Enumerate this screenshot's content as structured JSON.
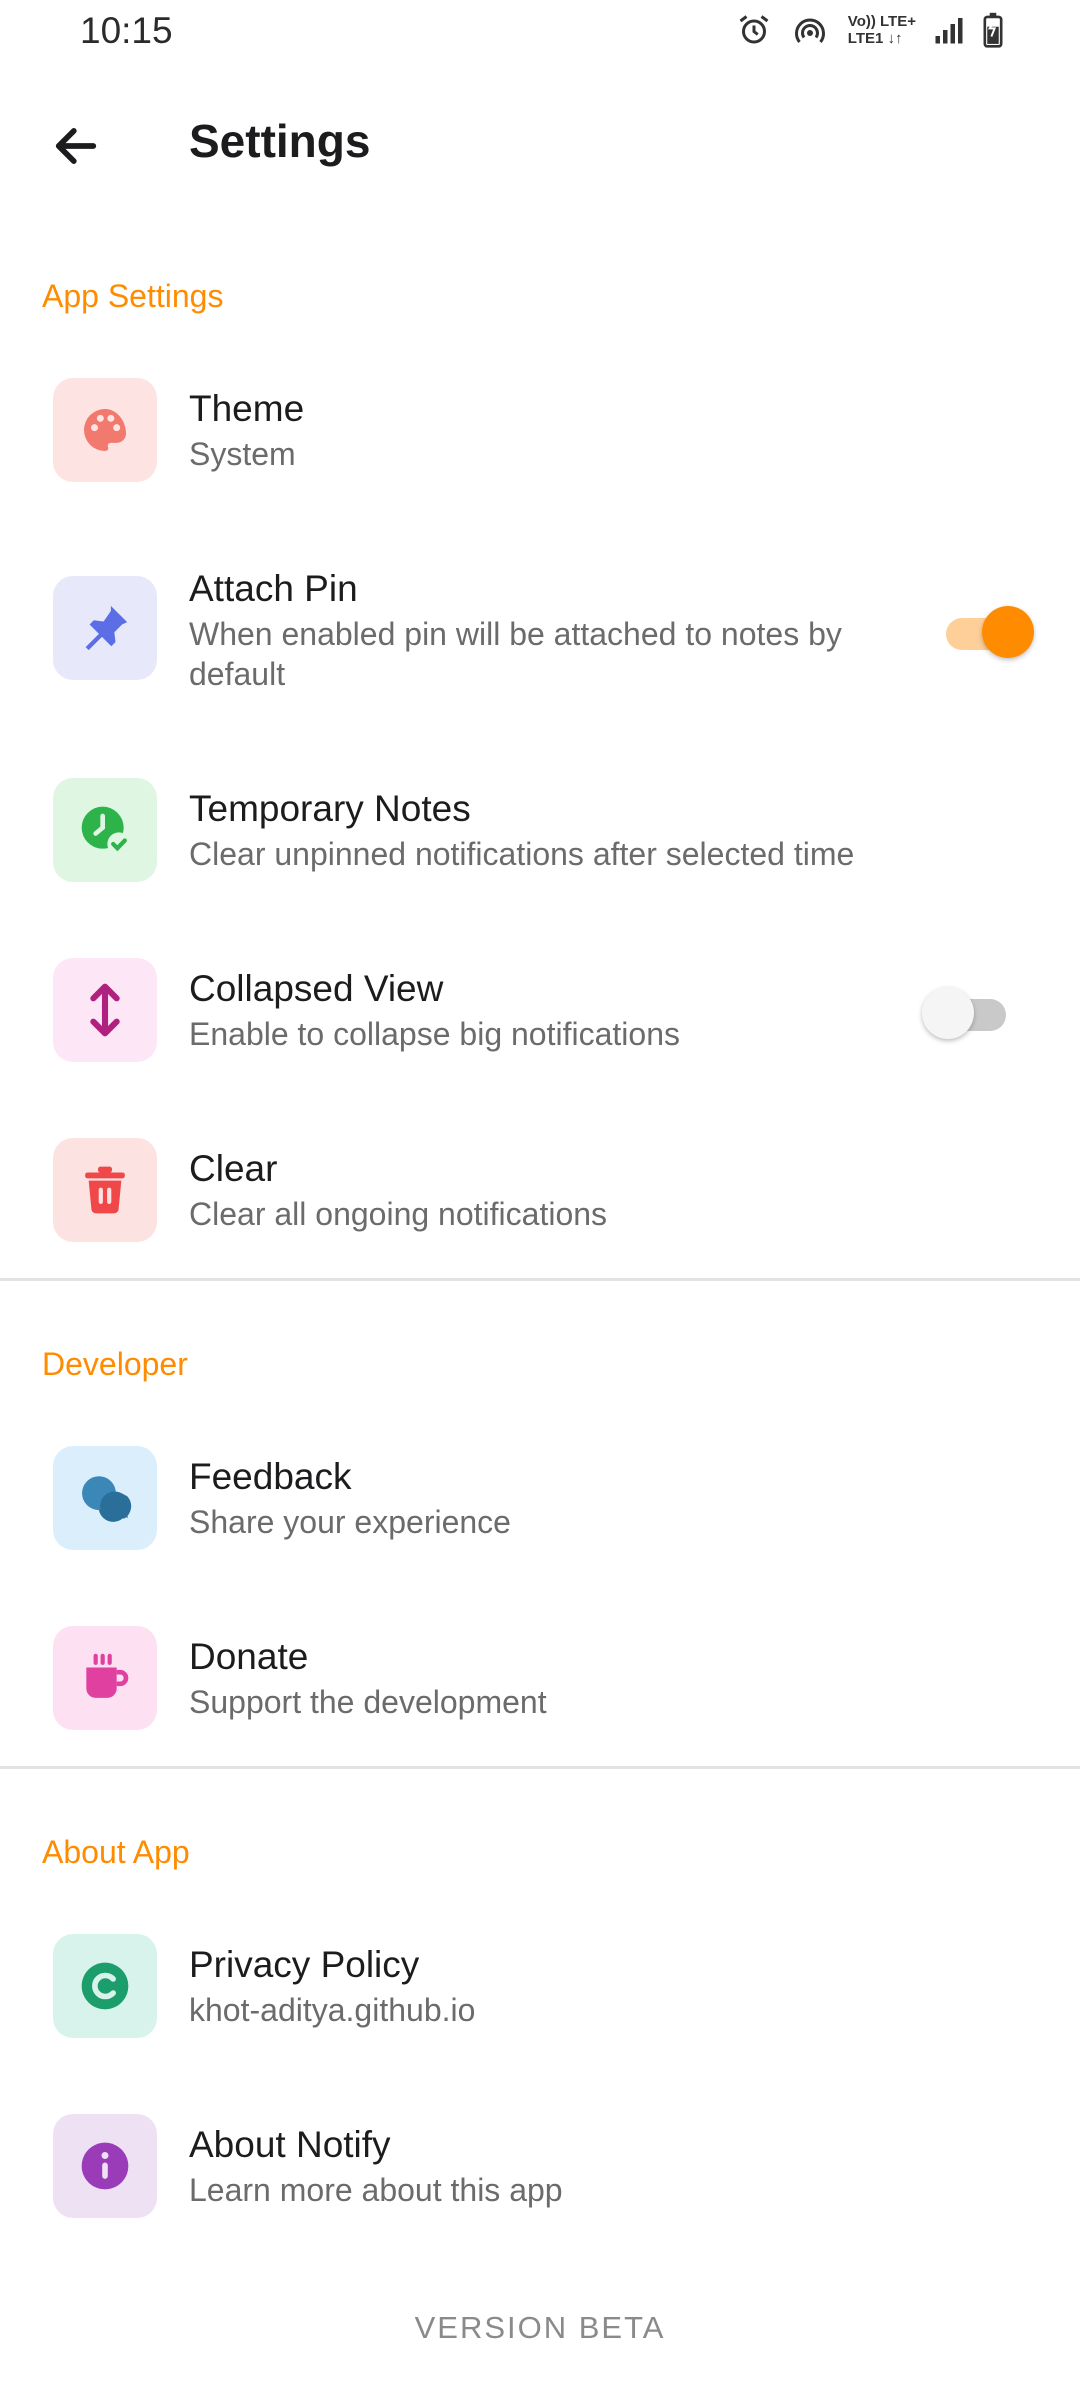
{
  "status_bar": {
    "time": "10:15",
    "network_label_top": "Vo)) LTE+",
    "network_label_bottom": "LTE1 ↓↑"
  },
  "app_bar": {
    "title": "Settings"
  },
  "sections": {
    "app_settings": {
      "header": "App Settings"
    },
    "developer": {
      "header": "Developer"
    },
    "about_app": {
      "header": "About App"
    }
  },
  "items": {
    "theme": {
      "title": "Theme",
      "subtitle": "System",
      "icon": "palette-icon",
      "tile_color": "#fde3e1",
      "icon_color": "#f2796e"
    },
    "attach_pin": {
      "title": "Attach Pin",
      "subtitle": "When enabled pin will be attached to notes by default",
      "icon": "pin-icon",
      "tile_color": "#e7e9fb",
      "icon_color": "#5b6ee6",
      "toggle_on": true
    },
    "temporary_notes": {
      "title": "Temporary Notes",
      "subtitle": "Clear unpinned notifications after selected time",
      "icon": "clock-check-icon",
      "tile_color": "#def6e2",
      "icon_color": "#2db34a"
    },
    "collapsed_view": {
      "title": "Collapsed View",
      "subtitle": "Enable to collapse big notifications",
      "icon": "expand-vertical-icon",
      "tile_color": "#fde6f6",
      "icon_color": "#b0207f",
      "toggle_on": false
    },
    "clear": {
      "title": "Clear",
      "subtitle": "Clear all ongoing notifications",
      "icon": "trash-icon",
      "tile_color": "#fde2e2",
      "icon_color": "#f04848"
    },
    "feedback": {
      "title": "Feedback",
      "subtitle": "Share your experience",
      "icon": "chat-bubbles-icon",
      "tile_color": "#dbeefb",
      "icon_color": "#3b88b8"
    },
    "donate": {
      "title": "Donate",
      "subtitle": "Support the development",
      "icon": "coffee-cup-icon",
      "tile_color": "#fde0f2",
      "icon_color": "#e0409f"
    },
    "privacy_policy": {
      "title": "Privacy Policy",
      "subtitle": "khot-aditya.github.io",
      "icon": "copyright-icon",
      "tile_color": "#d8f3ec",
      "icon_color": "#1b9e6b"
    },
    "about_notify": {
      "title": "About Notify",
      "subtitle": "Learn more about this app",
      "icon": "info-icon",
      "tile_color": "#efe1f4",
      "icon_color": "#9a3bb8"
    }
  },
  "footer": {
    "version": "VERSION  BETA"
  },
  "colors": {
    "accent": "#ff8c00",
    "toggle_on_track": "#ffcf99",
    "toggle_off_track": "#c9c9c9"
  }
}
